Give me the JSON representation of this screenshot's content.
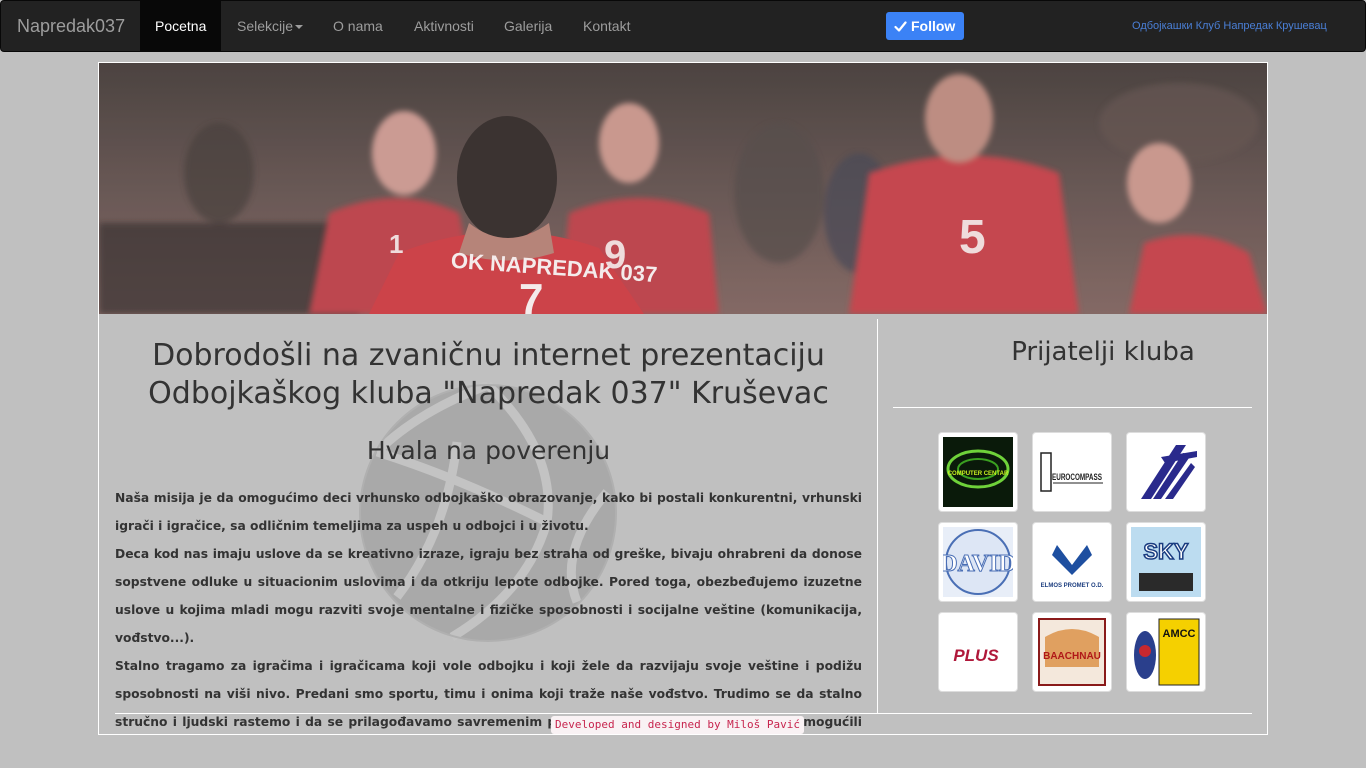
{
  "navbar": {
    "brand": "Napredak037",
    "items": [
      {
        "label": "Pocetna"
      },
      {
        "label": "Selekcije"
      },
      {
        "label": "O nama"
      },
      {
        "label": "Aktivnosti"
      },
      {
        "label": "Galerija"
      },
      {
        "label": "Kontakt"
      }
    ],
    "active_index": 0,
    "follow_label": "Follow",
    "right_text": "Одбојкашки Клуб Напредак Крушевац"
  },
  "hero": {
    "jersey_text": "OK NAPREDAK 037",
    "player_numbers": [
      "7",
      "9",
      "5",
      "1"
    ]
  },
  "main": {
    "title": "Dobrodošli na zvaničnu internet prezentaciju Odbojkaškog kluba \"Napredak 037\" Kruševac",
    "subtitle": "Hvala na poverenju",
    "paragraphs": [
      "Naša misija je da omogućimo deci vrhunsko odbojkaško obrazovanje, kako bi postali konkurentni, vrhunski igrači i igračice, sa odličnim temeljima za uspeh u odbojci i u životu.",
      "Deca kod nas imaju uslove da se kreativno izraze, igraju bez straha od greške, bivaju ohrabreni da donose sopstvene odluke u situacionim uslovima i da otkriju lepote odbojke. Pored toga, obezbeđujemo izuzetne uslove u kojima mladi mogu razviti svoje mentalne i fizičke sposobnosti i socijalne veštine (komunikacija, vođstvo...).",
      "Stalno tragamo za igračima i igračicama koji vole odbojku i koji žele da razvijaju svoje veštine i podižu sposobnosti na viši nivo. Predani smo sportu, timu i onima koji traže naše vođstvo. Trudimo se da stalno stručno i ljudski rastemo i da se prilagođavamo savremenim potrebama i uslovima, kako bismo omogućili svojim sportistima da ostvare najviše ciljeve."
    ]
  },
  "sidebar": {
    "title": "Prijatelji kluba",
    "logos": [
      {
        "text": "COMPUTER CENTAR"
      },
      {
        "text": "EUROCOMPASS"
      },
      {
        "text": ""
      },
      {
        "text": "DAVID"
      },
      {
        "text": "ELMOS PROMET O.D."
      },
      {
        "text": "SKY"
      },
      {
        "text": "PLUS"
      },
      {
        "text": "BAACHNAU"
      },
      {
        "text": "AMCC"
      }
    ]
  },
  "footer": {
    "credit": "Developed and designed by Miloš Pavić"
  },
  "colors": {
    "navbar_bg": "#222222",
    "page_bg": "#c0c0c0",
    "follow_btn": "#3b82f6",
    "credit_text": "#c7254e"
  }
}
